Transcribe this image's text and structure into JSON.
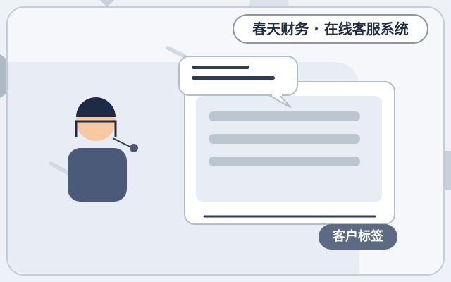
{
  "app": {
    "title": "春天财务 · 在线客服系统"
  },
  "customer_tag": {
    "label": "客户标签"
  },
  "colors": {
    "background": "#eef2f8",
    "panel": "#ffffff",
    "accent_dark": "#2f3b52",
    "agent_body": "#4a5a78",
    "skeleton": "#bcc5d2",
    "tag": "#5c6a84"
  },
  "icons": {
    "agent": "customer-service-agent-icon",
    "chat_bubble": "speech-bubble-icon",
    "chat_window": "chat-window-icon"
  }
}
